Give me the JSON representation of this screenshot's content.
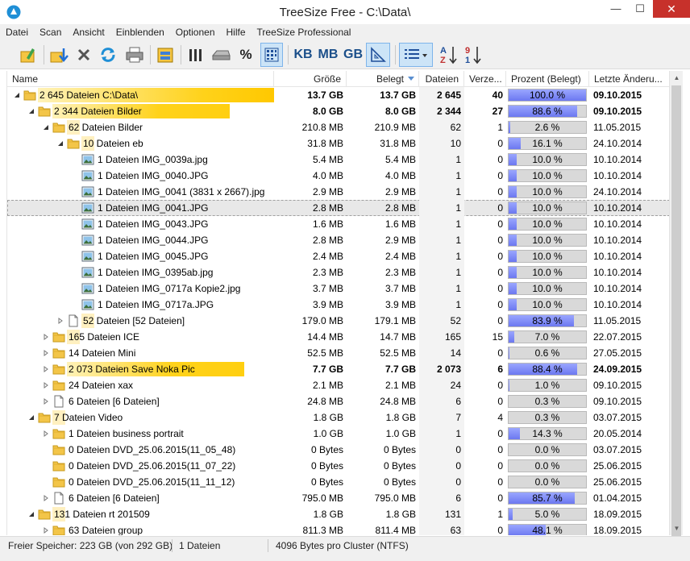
{
  "window": {
    "title": "TreeSize Free - C:\\Data\\",
    "minimize": "—",
    "maximize": "☐",
    "close": "✕"
  },
  "menu": [
    "Datei",
    "Scan",
    "Ansicht",
    "Einblenden",
    "Optionen",
    "Hilfe",
    "TreeSize Professional"
  ],
  "toolbar": {
    "kb": "KB",
    "mb": "MB",
    "gb": "GB",
    "percent": "%"
  },
  "columns": {
    "name": "Name",
    "size": "Größe",
    "alloc": "Belegt",
    "files": "Dateien",
    "folders": "Verze...",
    "percent": "Prozent (Belegt)",
    "modified": "Letzte Änderu..."
  },
  "rows": [
    {
      "level": 0,
      "exp": "open",
      "icon": "folder",
      "bold": true,
      "hl": "full",
      "name": "2 645 Dateien   C:\\Data\\",
      "size": "13.7 GB",
      "alloc": "13.7 GB",
      "files": "2 645",
      "folders": "40",
      "pct": 100.0,
      "pct_label": "100.0 %",
      "date": "09.10.2015"
    },
    {
      "level": 1,
      "exp": "open",
      "icon": "folder",
      "bold": true,
      "hl": "large",
      "name": "2 344 Dateien   Bilder",
      "size": "8.0 GB",
      "alloc": "8.0 GB",
      "files": "2 344",
      "folders": "27",
      "pct": 88.6,
      "pct_label": "88.6 %",
      "date": "09.10.2015"
    },
    {
      "level": 2,
      "exp": "open",
      "icon": "folder",
      "bold": false,
      "hl": "small",
      "name": "62 Dateien   Bilder",
      "size": "210.8 MB",
      "alloc": "210.9 MB",
      "files": "62",
      "folders": "1",
      "pct": 2.6,
      "pct_label": "2.6 %",
      "date": "11.05.2015"
    },
    {
      "level": 3,
      "exp": "open",
      "icon": "folder",
      "bold": false,
      "hl": "small",
      "name": "10 Dateien   eb",
      "size": "31.8 MB",
      "alloc": "31.8 MB",
      "files": "10",
      "folders": "0",
      "pct": 16.1,
      "pct_label": "16.1 %",
      "date": "24.10.2014"
    },
    {
      "level": 4,
      "exp": "none",
      "icon": "image",
      "bold": false,
      "hl": "none",
      "name": "1 Dateien   IMG_0039a.jpg",
      "size": "5.4 MB",
      "alloc": "5.4 MB",
      "files": "1",
      "folders": "0",
      "pct": 10.0,
      "pct_label": "10.0 %",
      "date": "10.10.2014"
    },
    {
      "level": 4,
      "exp": "none",
      "icon": "image",
      "bold": false,
      "hl": "none",
      "name": "1 Dateien   IMG_0040.JPG",
      "size": "4.0 MB",
      "alloc": "4.0 MB",
      "files": "1",
      "folders": "0",
      "pct": 10.0,
      "pct_label": "10.0 %",
      "date": "10.10.2014"
    },
    {
      "level": 4,
      "exp": "none",
      "icon": "image",
      "bold": false,
      "hl": "none",
      "name": "1 Dateien   IMG_0041 (3831 x 2667).jpg",
      "size": "2.9 MB",
      "alloc": "2.9 MB",
      "files": "1",
      "folders": "0",
      "pct": 10.0,
      "pct_label": "10.0 %",
      "date": "24.10.2014"
    },
    {
      "level": 4,
      "exp": "none",
      "icon": "image",
      "bold": false,
      "hl": "none",
      "selected": true,
      "name": "1 Dateien   IMG_0041.JPG",
      "size": "2.8 MB",
      "alloc": "2.8 MB",
      "files": "1",
      "folders": "0",
      "pct": 10.0,
      "pct_label": "10.0 %",
      "date": "10.10.2014"
    },
    {
      "level": 4,
      "exp": "none",
      "icon": "image",
      "bold": false,
      "hl": "none",
      "name": "1 Dateien   IMG_0043.JPG",
      "size": "1.6 MB",
      "alloc": "1.6 MB",
      "files": "1",
      "folders": "0",
      "pct": 10.0,
      "pct_label": "10.0 %",
      "date": "10.10.2014"
    },
    {
      "level": 4,
      "exp": "none",
      "icon": "image",
      "bold": false,
      "hl": "none",
      "name": "1 Dateien   IMG_0044.JPG",
      "size": "2.8 MB",
      "alloc": "2.9 MB",
      "files": "1",
      "folders": "0",
      "pct": 10.0,
      "pct_label": "10.0 %",
      "date": "10.10.2014"
    },
    {
      "level": 4,
      "exp": "none",
      "icon": "image",
      "bold": false,
      "hl": "none",
      "name": "1 Dateien   IMG_0045.JPG",
      "size": "2.4 MB",
      "alloc": "2.4 MB",
      "files": "1",
      "folders": "0",
      "pct": 10.0,
      "pct_label": "10.0 %",
      "date": "10.10.2014"
    },
    {
      "level": 4,
      "exp": "none",
      "icon": "image",
      "bold": false,
      "hl": "none",
      "name": "1 Dateien   IMG_0395ab.jpg",
      "size": "2.3 MB",
      "alloc": "2.3 MB",
      "files": "1",
      "folders": "0",
      "pct": 10.0,
      "pct_label": "10.0 %",
      "date": "10.10.2014"
    },
    {
      "level": 4,
      "exp": "none",
      "icon": "image",
      "bold": false,
      "hl": "none",
      "name": "1 Dateien   IMG_0717a Kopie2.jpg",
      "size": "3.7 MB",
      "alloc": "3.7 MB",
      "files": "1",
      "folders": "0",
      "pct": 10.0,
      "pct_label": "10.0 %",
      "date": "10.10.2014"
    },
    {
      "level": 4,
      "exp": "none",
      "icon": "image",
      "bold": false,
      "hl": "none",
      "name": "1 Dateien   IMG_0717a.JPG",
      "size": "3.9 MB",
      "alloc": "3.9 MB",
      "files": "1",
      "folders": "0",
      "pct": 10.0,
      "pct_label": "10.0 %",
      "date": "10.10.2014"
    },
    {
      "level": 3,
      "exp": "closed",
      "icon": "file",
      "bold": false,
      "hl": "small",
      "name": "52 Dateien   [52 Dateien]",
      "size": "179.0 MB",
      "alloc": "179.1 MB",
      "files": "52",
      "folders": "0",
      "pct": 83.9,
      "pct_label": "83.9 %",
      "date": "11.05.2015"
    },
    {
      "level": 2,
      "exp": "closed",
      "icon": "folder",
      "bold": false,
      "hl": "small",
      "name": "165 Dateien   ICE",
      "size": "14.4 MB",
      "alloc": "14.7 MB",
      "files": "165",
      "folders": "15",
      "pct": 7.0,
      "pct_label": "7.0 %",
      "date": "22.07.2015"
    },
    {
      "level": 2,
      "exp": "closed",
      "icon": "folder",
      "bold": false,
      "hl": "none",
      "name": "14 Dateien   Mini",
      "size": "52.5 MB",
      "alloc": "52.5 MB",
      "files": "14",
      "folders": "0",
      "pct": 0.6,
      "pct_label": "0.6 %",
      "date": "27.05.2015"
    },
    {
      "level": 2,
      "exp": "closed",
      "icon": "folder",
      "bold": true,
      "hl": "large",
      "name": "2 073 Dateien   Save Noka Pic",
      "size": "7.7 GB",
      "alloc": "7.7 GB",
      "files": "2 073",
      "folders": "6",
      "pct": 88.4,
      "pct_label": "88.4 %",
      "date": "24.09.2015"
    },
    {
      "level": 2,
      "exp": "closed",
      "icon": "folder",
      "bold": false,
      "hl": "none",
      "name": "24 Dateien   xax",
      "size": "2.1 MB",
      "alloc": "2.1 MB",
      "files": "24",
      "folders": "0",
      "pct": 1.0,
      "pct_label": "1.0 %",
      "date": "09.10.2015"
    },
    {
      "level": 2,
      "exp": "closed",
      "icon": "file",
      "bold": false,
      "hl": "none",
      "name": "6 Dateien   [6 Dateien]",
      "size": "24.8 MB",
      "alloc": "24.8 MB",
      "files": "6",
      "folders": "0",
      "pct": 0.3,
      "pct_label": "0.3 %",
      "date": "09.10.2015"
    },
    {
      "level": 1,
      "exp": "open",
      "icon": "folder",
      "bold": false,
      "hl": "small",
      "name": "7 Dateien   Video",
      "size": "1.8 GB",
      "alloc": "1.8 GB",
      "files": "7",
      "folders": "4",
      "pct": 0.3,
      "pct_label": "0.3 %",
      "date": "03.07.2015"
    },
    {
      "level": 2,
      "exp": "closed",
      "icon": "folder",
      "bold": false,
      "hl": "none",
      "name": "1 Dateien   business portrait",
      "size": "1.0 GB",
      "alloc": "1.0 GB",
      "files": "1",
      "folders": "0",
      "pct": 14.3,
      "pct_label": "14.3 %",
      "date": "20.05.2014"
    },
    {
      "level": 2,
      "exp": "none",
      "icon": "folder",
      "bold": false,
      "hl": "none",
      "name": "0 Dateien   DVD_25.06.2015(11_05_48)",
      "size": "0 Bytes",
      "alloc": "0 Bytes",
      "files": "0",
      "folders": "0",
      "pct": 0.0,
      "pct_label": "0.0 %",
      "date": "03.07.2015"
    },
    {
      "level": 2,
      "exp": "none",
      "icon": "folder",
      "bold": false,
      "hl": "none",
      "name": "0 Dateien   DVD_25.06.2015(11_07_22)",
      "size": "0 Bytes",
      "alloc": "0 Bytes",
      "files": "0",
      "folders": "0",
      "pct": 0.0,
      "pct_label": "0.0 %",
      "date": "25.06.2015"
    },
    {
      "level": 2,
      "exp": "none",
      "icon": "folder",
      "bold": false,
      "hl": "none",
      "name": "0 Dateien   DVD_25.06.2015(11_11_12)",
      "size": "0 Bytes",
      "alloc": "0 Bytes",
      "files": "0",
      "folders": "0",
      "pct": 0.0,
      "pct_label": "0.0 %",
      "date": "25.06.2015"
    },
    {
      "level": 2,
      "exp": "closed",
      "icon": "file",
      "bold": false,
      "hl": "none",
      "name": "6 Dateien   [6 Dateien]",
      "size": "795.0 MB",
      "alloc": "795.0 MB",
      "files": "6",
      "folders": "0",
      "pct": 85.7,
      "pct_label": "85.7 %",
      "date": "01.04.2015"
    },
    {
      "level": 1,
      "exp": "open",
      "icon": "folder",
      "bold": false,
      "hl": "small",
      "name": "131 Dateien   rt 201509",
      "size": "1.8 GB",
      "alloc": "1.8 GB",
      "files": "131",
      "folders": "1",
      "pct": 5.0,
      "pct_label": "5.0 %",
      "date": "18.09.2015"
    },
    {
      "level": 2,
      "exp": "closed",
      "icon": "folder",
      "bold": false,
      "hl": "none",
      "name": "63 Dateien   group",
      "size": "811.3 MB",
      "alloc": "811.4 MB",
      "files": "63",
      "folders": "0",
      "pct": 48.1,
      "pct_label": "48.1 %",
      "date": "18.09.2015"
    }
  ],
  "status": {
    "free": "Freier Speicher: 223 GB  (von 292 GB)",
    "files": "1  Dateien",
    "cluster": "4096  Bytes pro Cluster (NTFS)"
  }
}
